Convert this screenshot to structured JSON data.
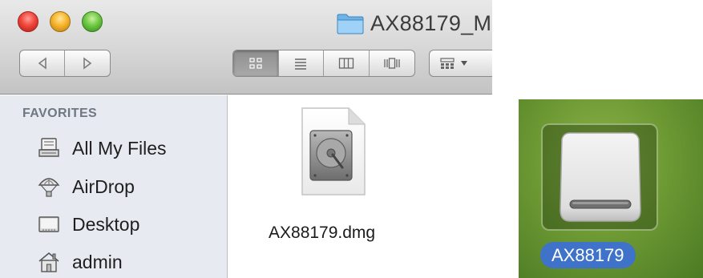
{
  "finder": {
    "window_title": "AX88179_M",
    "sidebar": {
      "heading": "FAVORITES",
      "items": [
        {
          "label": "All My Files",
          "icon": "all-my-files-icon"
        },
        {
          "label": "AirDrop",
          "icon": "airdrop-icon"
        },
        {
          "label": "Desktop",
          "icon": "desktop-icon"
        },
        {
          "label": "admin",
          "icon": "home-icon"
        }
      ]
    },
    "toolbar": {
      "nav": [
        "back-arrow-icon",
        "forward-arrow-icon"
      ],
      "views": [
        "icon-view-icon",
        "list-view-icon",
        "column-view-icon",
        "cover-flow-icon"
      ],
      "active_view": "icon-view-icon",
      "arrange": "arrange-menu-icon"
    },
    "file": {
      "name": "AX88179.dmg",
      "icon": "disk-image-icon"
    }
  },
  "desktop": {
    "drive": {
      "name": "AX88179",
      "icon": "external-drive-icon"
    },
    "colors": {
      "label_bg": "#3f73c9",
      "desktop_green": "#6e9a34"
    }
  }
}
